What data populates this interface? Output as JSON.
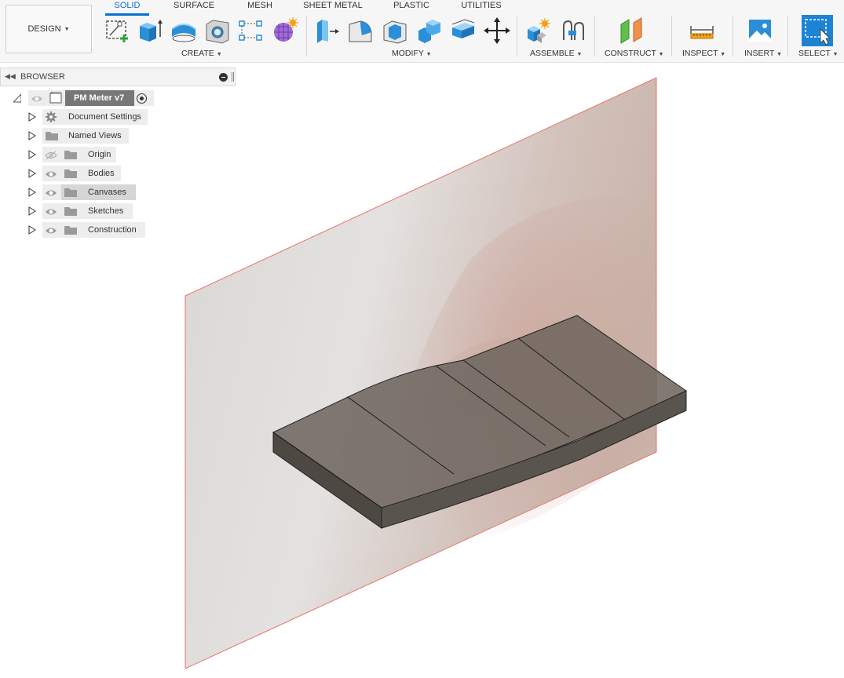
{
  "workspace": {
    "design_label": "DESIGN"
  },
  "tabs": [
    {
      "label": "SOLID",
      "active": true
    },
    {
      "label": "SURFACE",
      "active": false
    },
    {
      "label": "MESH",
      "active": false
    },
    {
      "label": "SHEET METAL",
      "active": false
    },
    {
      "label": "PLASTIC",
      "active": false
    },
    {
      "label": "UTILITIES",
      "active": false
    }
  ],
  "groups": {
    "create": "CREATE",
    "modify": "MODIFY",
    "assemble": "ASSEMBLE",
    "construct": "CONSTRUCT",
    "inspect": "INSPECT",
    "insert": "INSERT",
    "select": "SELECT"
  },
  "tools": {
    "create": [
      "create-sketch-icon",
      "extrude-icon",
      "revolve-icon",
      "hole-icon",
      "pattern-icon",
      "create-form-icon"
    ],
    "modify": [
      "press-pull-icon",
      "fillet-icon",
      "shell-icon",
      "combine-icon",
      "offset-face-icon",
      "move-icon"
    ],
    "assemble": [
      "new-component-icon",
      "joint-icon"
    ],
    "construct": [
      "offset-plane-icon"
    ],
    "inspect": [
      "measure-icon"
    ],
    "insert": [
      "insert-image-icon"
    ],
    "select": [
      "select-window-icon"
    ]
  },
  "browser": {
    "title": "BROWSER",
    "root": "PM Meter v7",
    "items": [
      {
        "label": "Document Settings",
        "icon": "gear-icon"
      },
      {
        "label": "Named Views",
        "icon": "folder-icon"
      },
      {
        "label": "Origin",
        "icon": "folder-icon",
        "visibility": "hidden"
      },
      {
        "label": "Bodies",
        "icon": "folder-icon",
        "visibility": "visible"
      },
      {
        "label": "Canvases",
        "icon": "folder-icon",
        "visibility": "visible",
        "selected": true
      },
      {
        "label": "Sketches",
        "icon": "folder-icon",
        "visibility": "visible"
      },
      {
        "label": "Construction",
        "icon": "folder-icon",
        "visibility": "visible"
      }
    ]
  },
  "colors": {
    "accent": "#0a6fd1",
    "plane_edge": "#e8736a",
    "body_top": "#6f6760",
    "body_side": "#4e4842",
    "select_blue": "#1d84d4"
  }
}
